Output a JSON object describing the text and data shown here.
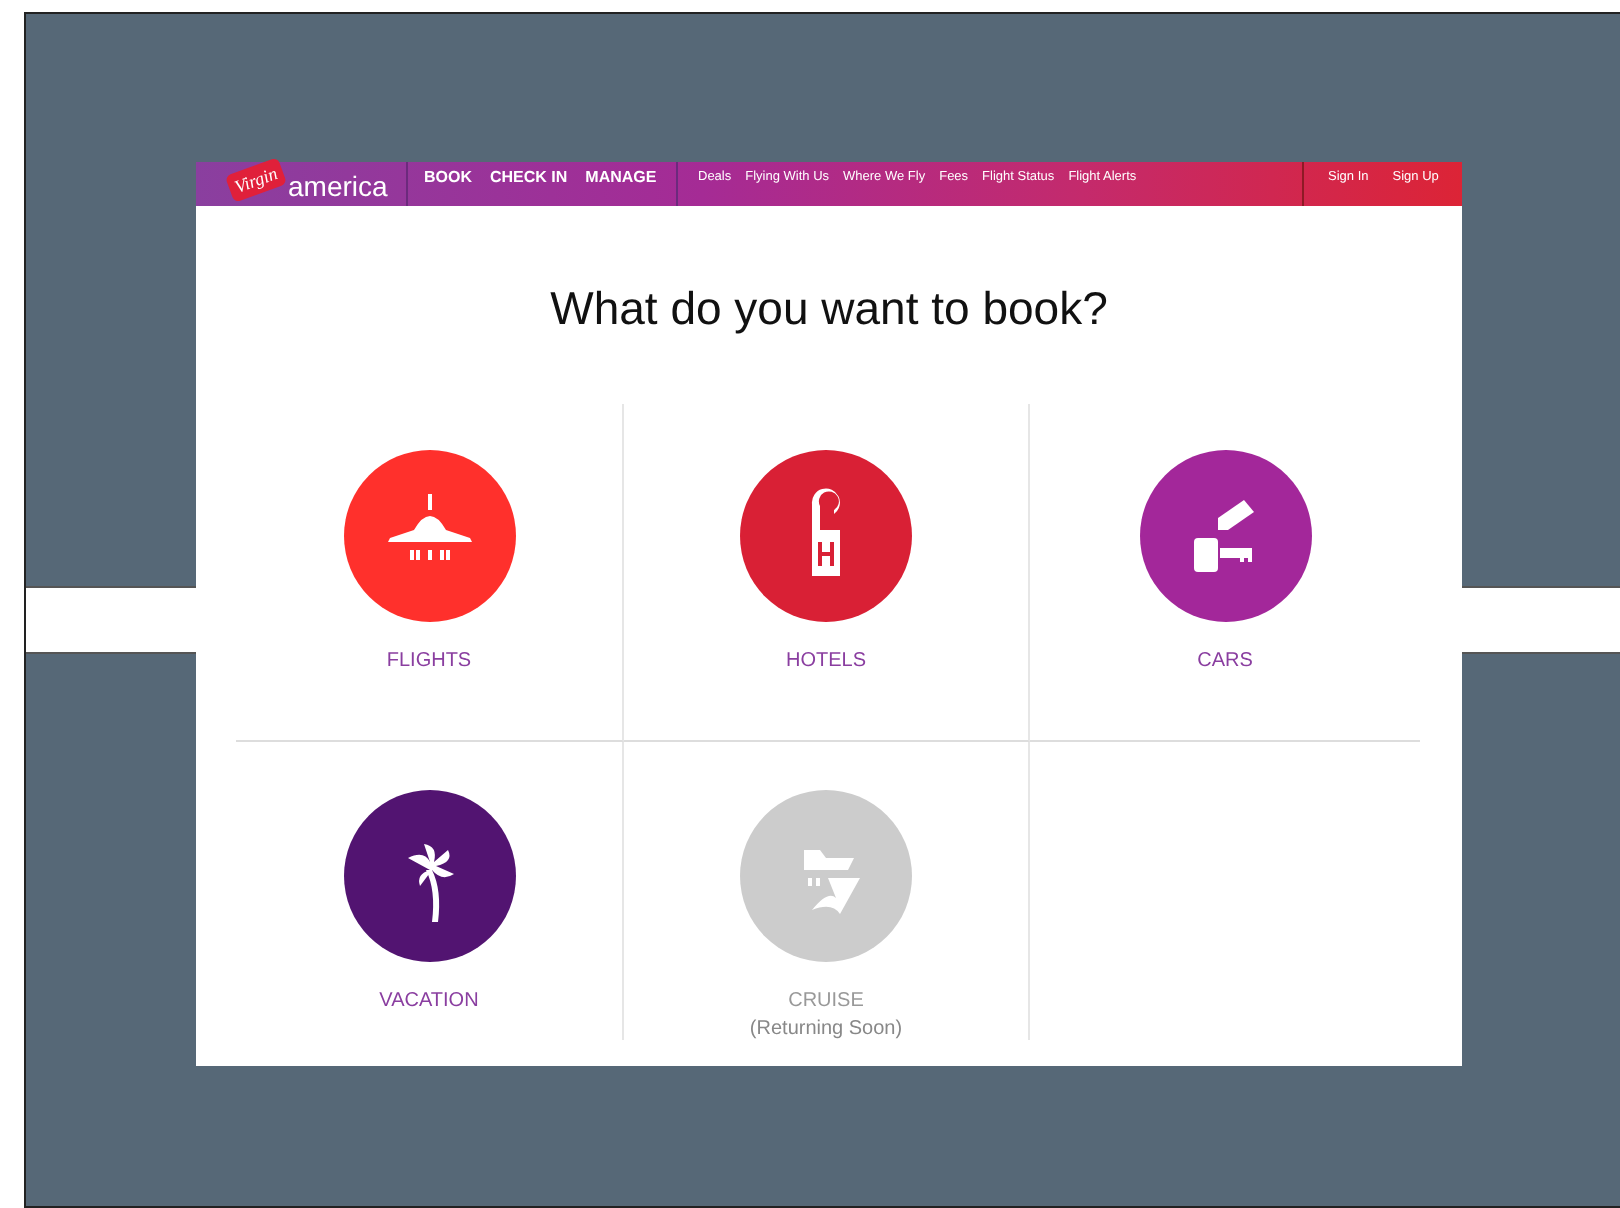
{
  "logo": {
    "script": "Virgin",
    "word": "america"
  },
  "main_nav": [
    "BOOK",
    "CHECK IN",
    "MANAGE"
  ],
  "secondary_nav": [
    "Deals",
    "Flying With Us",
    "Where We Fly",
    "Fees",
    "Flight Status",
    "Flight Alerts"
  ],
  "account_nav": [
    "Sign In",
    "Sign Up"
  ],
  "heading": "What do you want to book?",
  "options": [
    {
      "label": "FLIGHTS",
      "color": "#ff302c",
      "disabled": false
    },
    {
      "label": "HOTELS",
      "color": "#d92035",
      "disabled": false
    },
    {
      "label": "CARS",
      "color": "#a3279a",
      "disabled": false
    },
    {
      "label": "VACATION",
      "color": "#521471",
      "disabled": false
    },
    {
      "label": "CRUISE",
      "note": "(Returning Soon)",
      "color": "#cccccc",
      "disabled": true
    }
  ]
}
